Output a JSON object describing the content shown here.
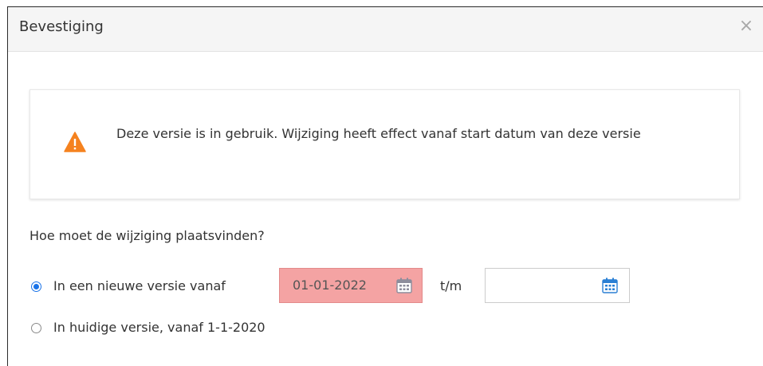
{
  "dialog": {
    "title": "Bevestiging",
    "close_symbol": "×",
    "close_icon": "close-icon"
  },
  "warning": {
    "icon": "warning-triangle-icon",
    "icon_color": "#f5821f",
    "text": "Deze versie is in gebruik. Wijziging heeft effect vanaf start datum van deze versie"
  },
  "question": {
    "label": "Hoe moet de wijziging plaatsvinden?"
  },
  "options": {
    "new_version": {
      "label": "In een nieuwe versie vanaf",
      "selected": true,
      "from_date": "01-01-2022",
      "from_date_invalid": true,
      "until_label": "t/m",
      "until_date": ""
    },
    "current_version": {
      "label": "In huidige versie, vanaf 1-1-2020",
      "selected": false
    }
  },
  "colors": {
    "accent": "#1a73e8",
    "invalid_field": "#f4a3a3",
    "calendar_icon": "#2a7fd4"
  }
}
